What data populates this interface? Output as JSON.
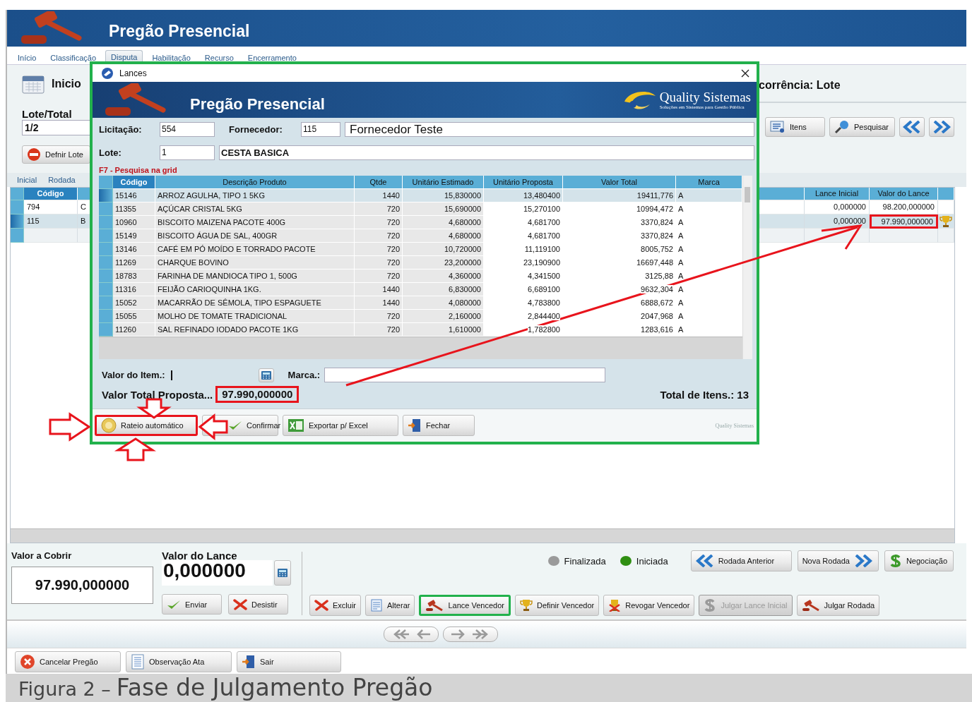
{
  "window": {
    "title": "Pregão Presencial"
  },
  "tabs": [
    {
      "label": "Início",
      "selected": false
    },
    {
      "label": "Classificação",
      "selected": false
    },
    {
      "label": "Disputa",
      "selected": true
    },
    {
      "label": "Habilitação",
      "selected": false
    },
    {
      "label": "Recurso",
      "selected": false
    },
    {
      "label": "Encerramento",
      "selected": false
    }
  ],
  "left_panel": {
    "heading": "Inicio",
    "lote_total_label": "Lote/Total",
    "lote_total_value": "1/2",
    "define_button": "Defnir Lote"
  },
  "subtabs": [
    {
      "label": "Inicial",
      "selected": false
    },
    {
      "label": "Rodada",
      "selected": false
    }
  ],
  "right_panel": {
    "heading": "corrência: Lote",
    "buttons": [
      {
        "label": "Itens"
      },
      {
        "label": "Pesquisar"
      }
    ]
  },
  "bids_grid": {
    "columns": [
      "Código",
      "Lance Inicial",
      "Valor do Lance"
    ],
    "rows": [
      {
        "code": "794",
        "name": "C",
        "initial": "0,000000",
        "bid": "98.200,000000",
        "selected": false,
        "winner": false,
        "highlighted": false
      },
      {
        "code": "115",
        "name": "B",
        "initial": "0,000000",
        "bid": "97.990,000000",
        "selected": true,
        "winner": true,
        "highlighted": true
      }
    ]
  },
  "bottom": {
    "cover_label": "Valor a Cobrir",
    "cover_value": "97.990,000000",
    "bid_label": "Valor do Lance",
    "bid_value": "0,000000",
    "bid_buttons": [
      {
        "label": "Enviar"
      },
      {
        "label": "Desistir"
      }
    ],
    "legend": [
      {
        "label": "Finalizada",
        "color": "#9a9a9a"
      },
      {
        "label": "Iniciada",
        "color": "#2f8f12"
      }
    ],
    "round_buttons": [
      {
        "label": "Rodada Anterior"
      },
      {
        "label": "Nova Rodada"
      },
      {
        "label": "Negociação"
      }
    ],
    "actions": [
      {
        "label": "Excluir",
        "disabled": false,
        "highlighted": false
      },
      {
        "label": "Alterar",
        "disabled": false,
        "highlighted": false
      },
      {
        "label": "Lance Vencedor",
        "disabled": false,
        "highlighted": true
      },
      {
        "label": "Definir Vencedor",
        "disabled": false,
        "highlighted": false
      },
      {
        "label": "Revogar Vencedor",
        "disabled": false,
        "highlighted": false
      },
      {
        "label": "Julgar Lance Inicial",
        "disabled": true,
        "highlighted": false
      },
      {
        "label": "Julgar Rodada",
        "disabled": false,
        "highlighted": false
      }
    ]
  },
  "footer_buttons": [
    {
      "label": "Cancelar Pregão"
    },
    {
      "label": "Observação Ata"
    },
    {
      "label": "Sair"
    }
  ],
  "dialog": {
    "title": "Lances",
    "header_title": "Pregão Presencial",
    "logo_name": "Quality Sistemas",
    "logo_tagline": "Soluções em Sistemas para Gestão Pública",
    "licitacao_label": "Licitação:",
    "licitacao": "554",
    "fornecedor_label": "Fornecedor:",
    "fornecedor_code": "115",
    "fornecedor_name": "Fornecedor Teste",
    "lote_label": "Lote:",
    "lote": "1",
    "lote_name": "CESTA BASICA",
    "search_hint": "F7 - Pesquisa na grid",
    "columns": [
      "Código",
      "Descrição Produto",
      "Qtde",
      "Unitário Estimado",
      "Unitário Proposta",
      "Valor Total",
      "Marca"
    ],
    "rows": [
      {
        "cells": [
          "15146",
          "ARROZ AGULHA, TIPO 1 5KG",
          "1440",
          "15,830000",
          "13,480400",
          "19411,776",
          "A"
        ],
        "selected": true
      },
      {
        "cells": [
          "11355",
          "AÇÚCAR CRISTAL 5KG",
          "720",
          "15,690000",
          "15,270100",
          "10994,472",
          "A"
        ],
        "selected": false
      },
      {
        "cells": [
          "10960",
          "BISCOITO MAIZENA PACOTE 400G",
          "720",
          "4,680000",
          "4,681700",
          "3370,824",
          "A"
        ],
        "selected": false
      },
      {
        "cells": [
          "15149",
          "BISCOITO ÁGUA DE SAL, 400GR",
          "720",
          "4,680000",
          "4,681700",
          "3370,824",
          "A"
        ],
        "selected": false
      },
      {
        "cells": [
          "13146",
          "CAFÉ EM PÓ MOÍDO E TORRADO PACOTE",
          "720",
          "10,720000",
          "11,119100",
          "8005,752",
          "A"
        ],
        "selected": false
      },
      {
        "cells": [
          "11269",
          "CHARQUE BOVINO",
          "720",
          "23,200000",
          "23,190900",
          "16697,448",
          "A"
        ],
        "selected": false
      },
      {
        "cells": [
          "18783",
          "FARINHA DE MANDIOCA TIPO 1, 500G",
          "720",
          "4,360000",
          "4,341500",
          "3125,88",
          "A"
        ],
        "selected": false
      },
      {
        "cells": [
          "11316",
          "FEIJÃO CARIOQUINHA 1KG.",
          "1440",
          "6,830000",
          "6,689100",
          "9632,304",
          "A"
        ],
        "selected": false
      },
      {
        "cells": [
          "15052",
          "MACARRÃO DE SÊMOLA, TIPO ESPAGUETE",
          "1440",
          "4,080000",
          "4,783800",
          "6888,672",
          "A"
        ],
        "selected": false
      },
      {
        "cells": [
          "15055",
          "MOLHO DE TOMATE TRADICIONAL",
          "720",
          "2,160000",
          "2,844400",
          "2047,968",
          "A"
        ],
        "selected": false
      },
      {
        "cells": [
          "11260",
          "SAL REFINADO IODADO PACOTE 1KG",
          "720",
          "1,610000",
          "1,782800",
          "1283,616",
          "A"
        ],
        "selected": false
      }
    ],
    "item_value_label": "Valor do Item.:",
    "brand_label": "Marca.:",
    "total_label": "Valor Total Proposta...",
    "total_value": "97.990,000000",
    "total_highlighted": true,
    "items_count": "Total de Itens.: 13",
    "buttons": [
      {
        "label": "Rateio automático",
        "highlighted": true,
        "pointer_arrows": true
      },
      {
        "label": "Confirmar",
        "highlighted": false,
        "pointer_arrows": false
      },
      {
        "label": "Exportar p/ Excel",
        "highlighted": false,
        "pointer_arrows": false
      },
      {
        "label": "Fechar",
        "highlighted": false,
        "pointer_arrows": false
      }
    ],
    "footer_logo": "Quality Sistemas"
  },
  "annotations": {
    "dialog_framed": true,
    "proposal_to_bid_arrow": true
  },
  "caption": {
    "label": "Figura 2 –",
    "title": "Fase de Julgamento Pregão"
  }
}
